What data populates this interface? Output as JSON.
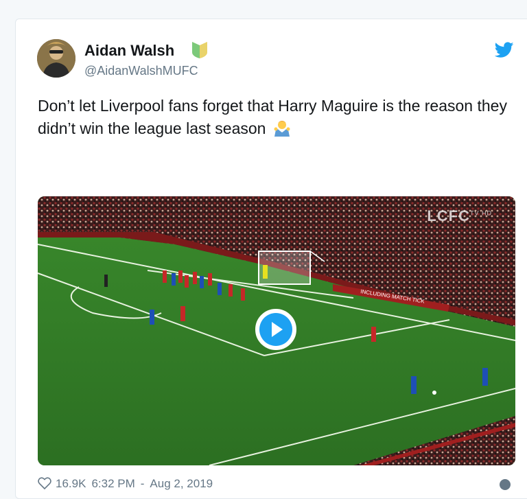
{
  "tweet": {
    "display_name": "Aidan Walsh",
    "handle": "@AidanWalshMUFC",
    "text": "Don’t let Liverpool fans forget that Harry Maguire is the reason they didn’t win the league last season",
    "emoji": "person-shrugging-emoji",
    "verified_badge": "green-shield-badge-icon"
  },
  "media": {
    "watermark": "LCFC",
    "watermark_sub": "TV HD",
    "ad_board_text": "INCLUDING MATCH TICK"
  },
  "footer": {
    "likes": "16.9K",
    "time": "6:32 PM",
    "date": "Aug 2, 2019"
  },
  "colors": {
    "brand_blue": "#1da1f2",
    "text": "#14171a",
    "muted": "#657786",
    "pitch": "#2f7a28"
  }
}
